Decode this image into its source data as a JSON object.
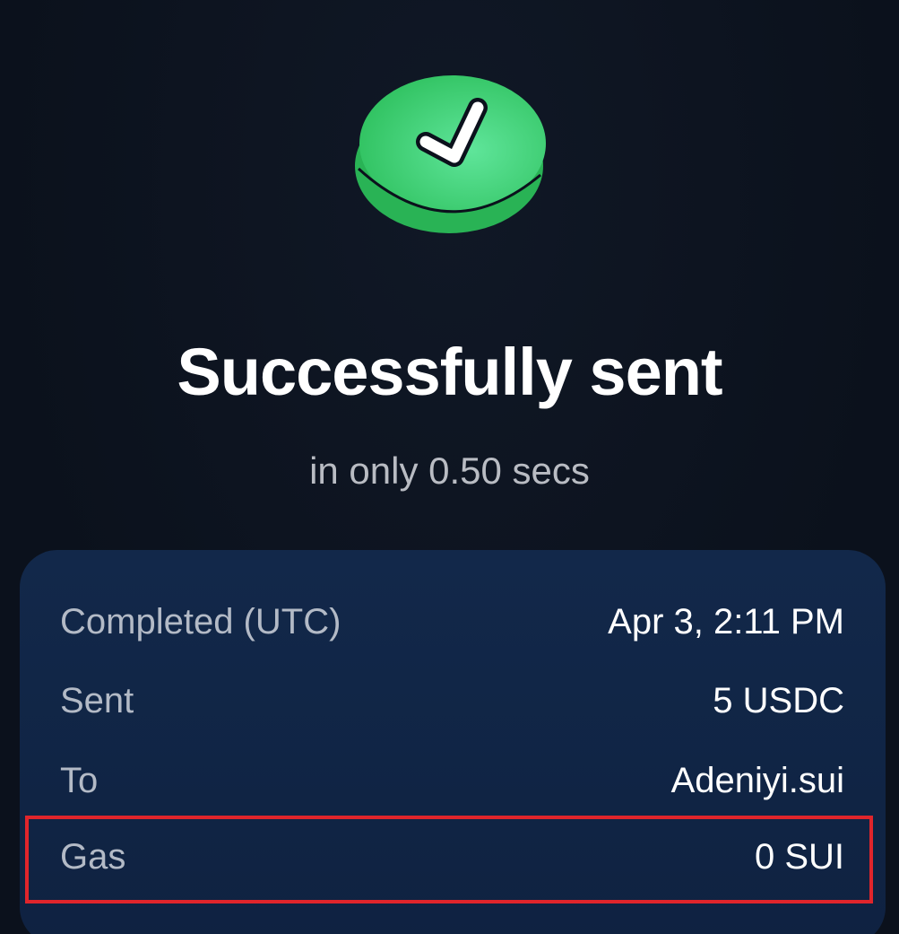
{
  "status": {
    "icon": "check-circle-icon",
    "title": "Successfully sent",
    "subtitle": "in only 0.50 secs"
  },
  "details": {
    "rows": [
      {
        "label": "Completed (UTC)",
        "value": "Apr 3, 2:11 PM"
      },
      {
        "label": "Sent",
        "value": "5 USDC"
      },
      {
        "label": "To",
        "value": "Adeniyi.sui"
      },
      {
        "label": "Gas",
        "value": "0 SUI"
      }
    ]
  },
  "colors": {
    "background": "#0b111c",
    "card": "#12284a",
    "success_green": "#3bd06c",
    "highlight_border": "#e0252b"
  }
}
